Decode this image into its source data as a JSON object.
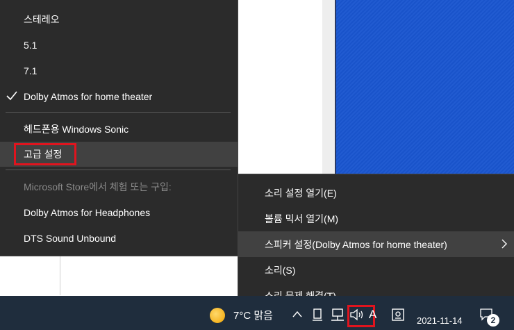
{
  "left_menu": {
    "items": [
      {
        "label": "스테레오",
        "checked": false,
        "disabled": false
      },
      {
        "label": "5.1",
        "checked": false,
        "disabled": false
      },
      {
        "label": "7.1",
        "checked": false,
        "disabled": false
      },
      {
        "label": "Dolby Atmos for home theater",
        "checked": true,
        "disabled": false
      }
    ],
    "items2": [
      {
        "label": "헤드폰용 Windows Sonic"
      },
      {
        "label": "고급 설정"
      }
    ],
    "store_header": "Microsoft Store에서 체험 또는 구입:",
    "store_items": [
      {
        "label": "Dolby Atmos for Headphones"
      },
      {
        "label": "DTS Sound Unbound"
      }
    ]
  },
  "right_menu": {
    "items": [
      {
        "label": "소리 설정 열기(E)"
      },
      {
        "label": "볼륨 믹서 열기(M)"
      },
      {
        "label": "스피커 설정(Dolby Atmos for home theater)",
        "submenu": true
      },
      {
        "label": "소리(S)"
      },
      {
        "label": "소리 문제 해결(T)"
      }
    ]
  },
  "taskbar": {
    "weather_temp": "7°C 맑음",
    "weather_icon": "sun-icon",
    "date": "2021-11-14",
    "notification_count": "2",
    "ime_label": "A"
  },
  "colors": {
    "menu_bg": "#2b2b2b",
    "highlight_red": "#e0141e",
    "taskbar_bg": "#1f2d3d",
    "desktop_blue": "#1a56d0"
  }
}
